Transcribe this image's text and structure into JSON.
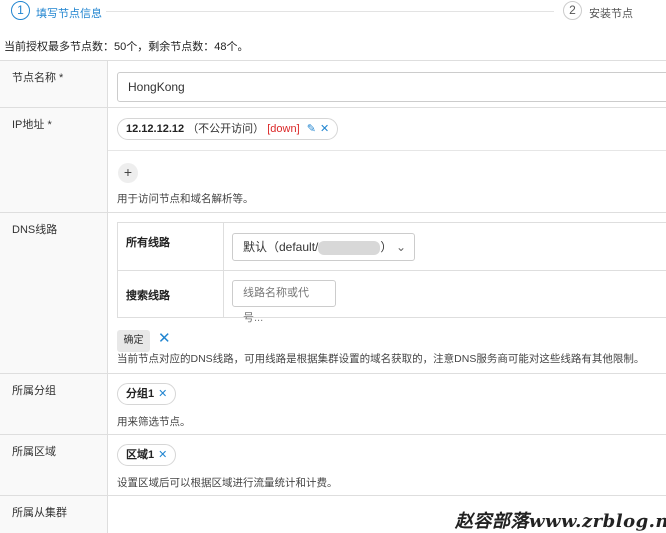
{
  "steps": [
    {
      "number": "1",
      "label": "填写节点信息"
    },
    {
      "number": "2",
      "label": "安装节点"
    }
  ],
  "license_notice": "当前授权最多节点数：50个，剩余节点数：48个。",
  "form": {
    "node_name": {
      "label": "节点名称 *",
      "value": "HongKong"
    },
    "ip": {
      "label": "IP地址 *",
      "address": "12.12.12.12",
      "access": "（不公开访问）",
      "status": "[down]",
      "help": "用于访问节点和域名解析等。"
    },
    "dns": {
      "label": "DNS线路",
      "all_routes_label": "所有线路",
      "selected_prefix": "默认（default/",
      "selected_suffix": "）",
      "search_label": "搜索线路",
      "search_placeholder": "线路名称或代号...",
      "confirm": "确定",
      "help": "当前节点对应的DNS线路，可用线路是根据集群设置的域名获取的，注意DNS服务商可能对这些线路有其他限制。"
    },
    "group": {
      "label": "所属分组",
      "tag": "分组1",
      "help": "用来筛选节点。"
    },
    "region": {
      "label": "所属区域",
      "tag": "区域1",
      "help": "设置区域后可以根据区域进行流量统计和计费。"
    },
    "sub_cluster": {
      "label": "所属从集群"
    }
  },
  "watermark": "赵容部落www.zrblog.net",
  "colors": {
    "accent": "#2185d0",
    "danger": "#db2828"
  }
}
